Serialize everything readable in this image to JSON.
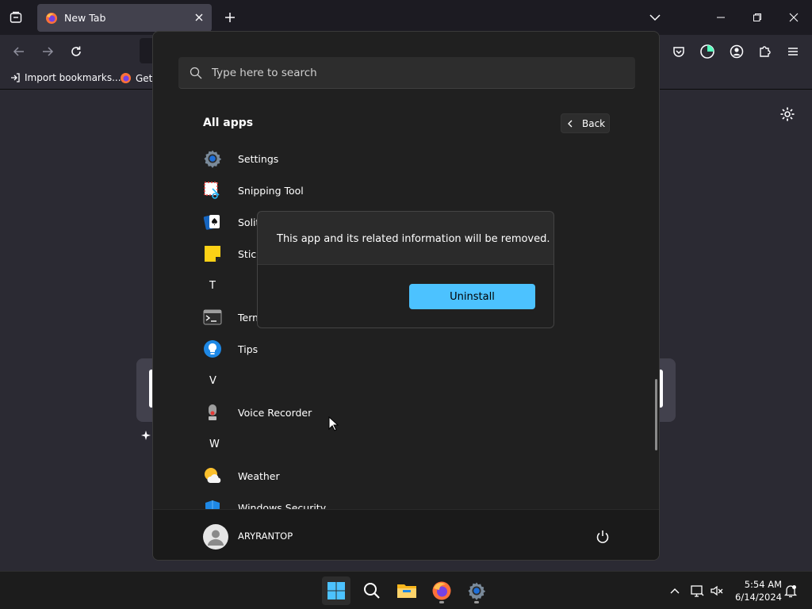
{
  "browser": {
    "tab": {
      "title": "New Tab"
    },
    "bookmarks": [
      {
        "label": "Import bookmarks..."
      },
      {
        "label": "Gett"
      }
    ]
  },
  "start_menu": {
    "search": {
      "placeholder": "Type here to search"
    },
    "section_title": "All apps",
    "back_label": "Back",
    "apps": [
      {
        "label": "Settings",
        "icon": "settings-icon"
      },
      {
        "label": "Snipping Tool",
        "icon": "snipping-tool-icon"
      },
      {
        "label": "Solit",
        "icon": "solitaire-icon"
      },
      {
        "label": "Stick",
        "icon": "sticky-notes-icon"
      },
      {
        "label": "T",
        "letter": true
      },
      {
        "label": "Term",
        "icon": "terminal-icon"
      },
      {
        "label": "Tips",
        "icon": "tips-icon"
      },
      {
        "label": "V",
        "letter": true
      },
      {
        "label": "Voice Recorder",
        "icon": "voice-recorder-icon"
      },
      {
        "label": "W",
        "letter": true
      },
      {
        "label": "Weather",
        "icon": "weather-icon"
      },
      {
        "label": "Windows Security",
        "icon": "windows-security-icon"
      }
    ],
    "user": {
      "name": "ARYRANTOP"
    }
  },
  "dialog": {
    "message": "This app and its related information will be removed.",
    "uninstall_label": "Uninstall"
  },
  "taskbar": {
    "time": "5:54 AM",
    "date": "6/14/2024"
  },
  "colors": {
    "accent": "#4cc2ff",
    "start_bg": "#202020",
    "browser_bg": "#2b2a33"
  }
}
